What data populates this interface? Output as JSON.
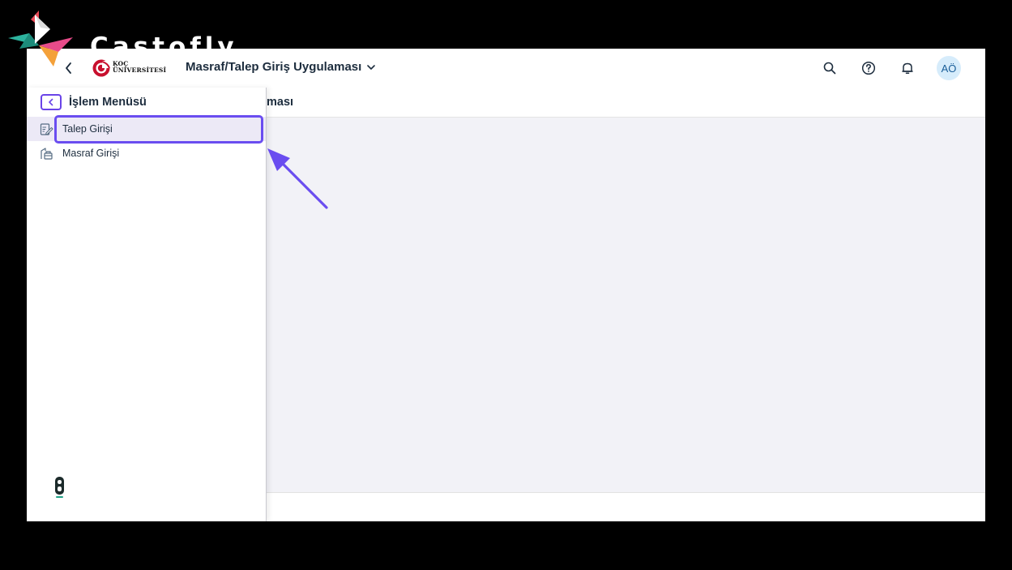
{
  "watermark": {
    "brand": "Castofly"
  },
  "shellbar": {
    "logo_line1": "KOÇ",
    "logo_line2": "ÜNİVERSİTESİ",
    "app_title": "Masraf/Talep Giriş Uygulaması",
    "avatar_initials": "AÖ"
  },
  "page": {
    "title_visible": "ması"
  },
  "sidemenu": {
    "title": "İşlem Menüsü",
    "items": [
      {
        "label": "Talep Girişi",
        "icon": "edit-form-icon",
        "active": true
      },
      {
        "label": "Masraf Girişi",
        "icon": "expense-form-icon",
        "active": false
      }
    ]
  },
  "colors": {
    "accent": "#6a4df0",
    "avatar_bg": "#d6ecfb",
    "active_item_bg": "#ece9f6",
    "content_bg": "#f2f2f7",
    "logo_red": "#c8102e"
  }
}
